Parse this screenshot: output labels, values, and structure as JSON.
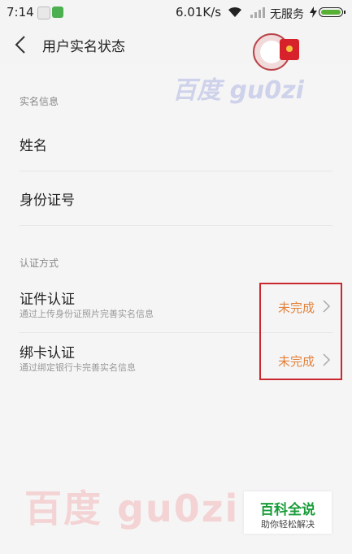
{
  "status_bar": {
    "time": "7:14",
    "network_speed": "6.01K/s",
    "carrier": "无服务",
    "battery_color": "#58b134"
  },
  "header": {
    "back_icon": "chevron-left-icon",
    "title": "用户实名状态"
  },
  "sections": {
    "realname_info": {
      "label": "实名信息",
      "rows": [
        {
          "label": "姓名"
        },
        {
          "label": "身份证号"
        }
      ]
    },
    "auth_methods": {
      "label": "认证方式",
      "rows": [
        {
          "label": "证件认证",
          "sub": "通过上传身份证照片完善实名信息",
          "status": "未完成"
        },
        {
          "label": "绑卡认证",
          "sub": "通过绑定银行卡完善实名信息",
          "status": "未完成"
        }
      ]
    }
  },
  "watermarks": {
    "top": "百度 gu0zi",
    "bottom": "百度 gu0zi"
  },
  "badge": {
    "title": "百科全说",
    "subtitle": "助你轻松解决"
  },
  "colors": {
    "status_accent": "#e2823a",
    "highlight_border": "#c9282e",
    "badge_green": "#1a9d3a"
  }
}
